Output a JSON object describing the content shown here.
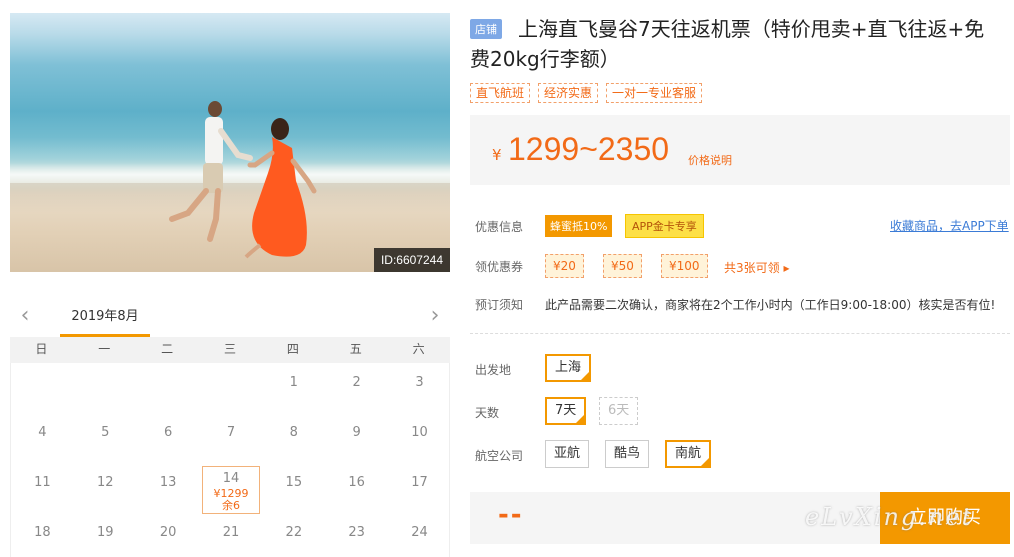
{
  "hero": {
    "id_label": "ID:6607244"
  },
  "calendar": {
    "month": "2019年8月",
    "weekdays": [
      "日",
      "一",
      "二",
      "三",
      "四",
      "五",
      "六"
    ],
    "rows": [
      [
        "",
        "",
        "",
        "",
        "1",
        "2",
        "3"
      ],
      [
        "4",
        "5",
        "6",
        "7",
        "8",
        "9",
        "10"
      ],
      [
        "11",
        "12",
        "13",
        "14",
        "15",
        "16",
        "17"
      ],
      [
        "18",
        "19",
        "20",
        "21",
        "22",
        "23",
        "24"
      ]
    ],
    "selected": {
      "day": "14",
      "price": "¥1299",
      "stock": "余6"
    }
  },
  "product": {
    "shop_tag": "店铺",
    "title": "上海直飞曼谷7天往返机票（特价甩卖+直飞往返+免费20kg行李额）",
    "tags": [
      "直飞航班",
      "经济实惠",
      "一对一专业客服"
    ],
    "price_currency": "¥",
    "price_range": "1299~2350",
    "price_explain": "价格说明"
  },
  "promo": {
    "label": "优惠信息",
    "badge1": "蜂蜜抵10%",
    "badge2": "APP金卡专享",
    "fav_link": "收藏商品，去APP下单"
  },
  "coupons": {
    "label": "领优惠券",
    "items": [
      "¥20",
      "¥50",
      "¥100"
    ],
    "more": "共3张可领 ▸"
  },
  "booking": {
    "label": "预订须知",
    "text": "此产品需要二次确认，商家将在2个工作小时内（工作日9:00-18:00）核实是否有位!"
  },
  "options": {
    "departure_label": "出发地",
    "departure": [
      "上海"
    ],
    "days_label": "天数",
    "days": [
      "7天",
      "6天"
    ],
    "airline_label": "航空公司",
    "airlines": [
      "亚航",
      "酷鸟",
      "南航"
    ]
  },
  "buy": {
    "price_placeholder": "--",
    "button": "立即购买"
  },
  "watermark": "eLvXing.net",
  "colors": {
    "accent": "#f39800",
    "price": "#f26a17",
    "link": "#3b7bd6"
  }
}
